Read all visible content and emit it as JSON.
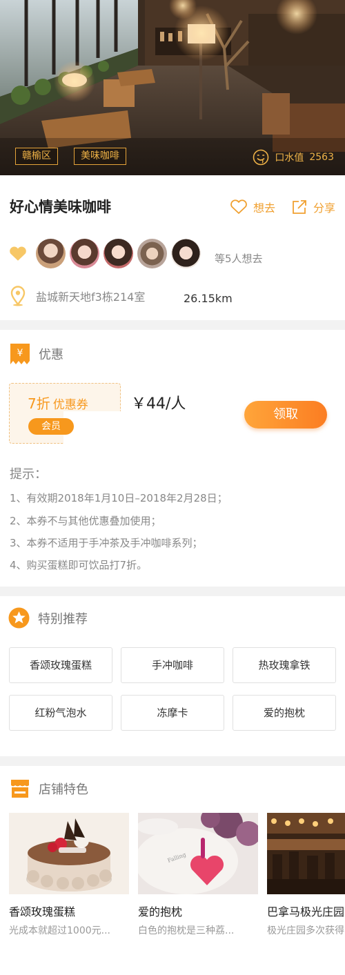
{
  "hero": {
    "tags": [
      "赣榆区",
      "美味咖啡"
    ],
    "koushui_label": "口水值",
    "koushui_value": "2563"
  },
  "shop": {
    "title": "好心情美味咖啡",
    "want_label": "想去",
    "share_label": "分享",
    "likes_text": "等5人想去",
    "address": "盐城新天地f3栋214室",
    "distance": "26.15km"
  },
  "coupon": {
    "section_title": "优惠",
    "rate": "7折",
    "rate_label": "优惠券",
    "member_label": "会员",
    "price": "￥44/人",
    "button_label": "领取",
    "tips_title": "提示：",
    "tips": [
      "1、有效期2018年1月10日–2018年2月28日；",
      "2、本券不与其他优惠叠加使用；",
      "3、本券不适用于手冲茶及手冲咖啡系列；",
      "4、购买蛋糕即可饮品打7折。"
    ]
  },
  "recommend": {
    "section_title": "特别推荐",
    "items": [
      "香颂玫瑰蛋糕",
      "手冲咖啡",
      "热玫瑰拿铁",
      "红粉气泡水",
      "冻摩卡",
      "爱的抱枕"
    ]
  },
  "features": {
    "section_title": "店铺特色",
    "items": [
      {
        "name": "香颂玫瑰蛋糕",
        "desc": "光成本就超过1000元..."
      },
      {
        "name": "爱的抱枕",
        "desc": "白色的抱枕是三种荔..."
      },
      {
        "name": "巴拿马极光庄园",
        "desc": "极光庄园多次获得"
      }
    ]
  },
  "colors": {
    "accent": "#f7981d",
    "gold": "#f0b347",
    "gap": "#f2f2f2"
  }
}
